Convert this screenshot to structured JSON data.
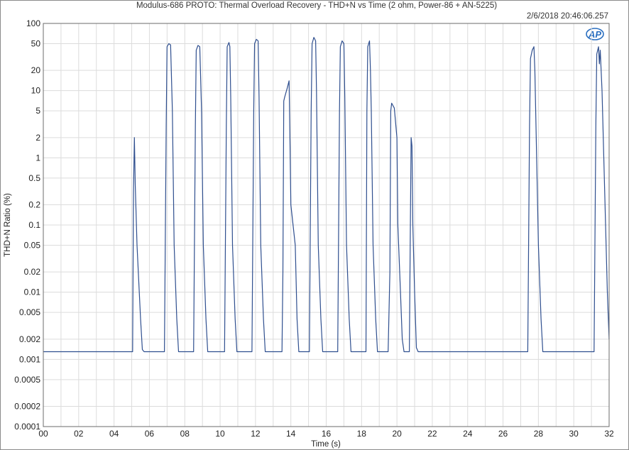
{
  "chart_data": {
    "type": "line",
    "title": "Modulus-686 PROTO: Thermal Overload Recovery - THD+N vs Time (2 ohm, Power-86 + AN-5225)",
    "timestamp": "2/6/2018 20:46:06.257",
    "logo": "AP",
    "xlabel": "Time (s)",
    "ylabel": "THD+N Ratio (%)",
    "x_scale": "linear",
    "y_scale": "log",
    "xlim": [
      0,
      32
    ],
    "ylim": [
      0.0001,
      100
    ],
    "grid": true,
    "x_ticks": [
      {
        "v": 0,
        "label": "00"
      },
      {
        "v": 2,
        "label": "02"
      },
      {
        "v": 4,
        "label": "04"
      },
      {
        "v": 6,
        "label": "06"
      },
      {
        "v": 8,
        "label": "08"
      },
      {
        "v": 10,
        "label": "10"
      },
      {
        "v": 12,
        "label": "12"
      },
      {
        "v": 14,
        "label": "14"
      },
      {
        "v": 16,
        "label": "16"
      },
      {
        "v": 18,
        "label": "18"
      },
      {
        "v": 20,
        "label": "20"
      },
      {
        "v": 22,
        "label": "22"
      },
      {
        "v": 24,
        "label": "24"
      },
      {
        "v": 26,
        "label": "26"
      },
      {
        "v": 28,
        "label": "28"
      },
      {
        "v": 30,
        "label": "30"
      },
      {
        "v": 32,
        "label": "32"
      }
    ],
    "y_ticks": [
      {
        "v": 100,
        "label": "100"
      },
      {
        "v": 50,
        "label": "50"
      },
      {
        "v": 20,
        "label": "20"
      },
      {
        "v": 10,
        "label": "10"
      },
      {
        "v": 5,
        "label": "5"
      },
      {
        "v": 2,
        "label": "2"
      },
      {
        "v": 1,
        "label": "1"
      },
      {
        "v": 0.5,
        "label": "0.5"
      },
      {
        "v": 0.2,
        "label": "0.2"
      },
      {
        "v": 0.1,
        "label": "0.1"
      },
      {
        "v": 0.05,
        "label": "0.05"
      },
      {
        "v": 0.02,
        "label": "0.02"
      },
      {
        "v": 0.01,
        "label": "0.01"
      },
      {
        "v": 0.005,
        "label": "0.005"
      },
      {
        "v": 0.002,
        "label": "0.002"
      },
      {
        "v": 0.001,
        "label": "0.001"
      },
      {
        "v": 0.0005,
        "label": "0.0005"
      },
      {
        "v": 0.0002,
        "label": "0.0002"
      },
      {
        "v": 0.0001,
        "label": "0.0001"
      }
    ],
    "series": [
      {
        "color": "#2f4f8f",
        "points": [
          [
            0,
            0.0013
          ],
          [
            5.05,
            0.0013
          ],
          [
            5.1,
            0.3
          ],
          [
            5.15,
            2.0
          ],
          [
            5.2,
            0.4
          ],
          [
            5.3,
            0.05
          ],
          [
            5.5,
            0.004
          ],
          [
            5.6,
            0.0014
          ],
          [
            5.7,
            0.0013
          ],
          [
            6.85,
            0.0013
          ],
          [
            6.95,
            3.0
          ],
          [
            7.0,
            45
          ],
          [
            7.1,
            50
          ],
          [
            7.2,
            48
          ],
          [
            7.3,
            5
          ],
          [
            7.4,
            0.05
          ],
          [
            7.55,
            0.004
          ],
          [
            7.65,
            0.0013
          ],
          [
            8.5,
            0.0013
          ],
          [
            8.6,
            3.0
          ],
          [
            8.65,
            40
          ],
          [
            8.75,
            47
          ],
          [
            8.85,
            45
          ],
          [
            8.95,
            5
          ],
          [
            9.05,
            0.05
          ],
          [
            9.2,
            0.004
          ],
          [
            9.3,
            0.0013
          ],
          [
            10.25,
            0.0013
          ],
          [
            10.35,
            3.0
          ],
          [
            10.4,
            45
          ],
          [
            10.5,
            52
          ],
          [
            10.55,
            45
          ],
          [
            10.6,
            8
          ],
          [
            10.7,
            0.05
          ],
          [
            10.85,
            0.004
          ],
          [
            10.95,
            0.0013
          ],
          [
            11.8,
            0.0013
          ],
          [
            11.9,
            5
          ],
          [
            11.95,
            50
          ],
          [
            12.05,
            58
          ],
          [
            12.15,
            55
          ],
          [
            12.2,
            8
          ],
          [
            12.3,
            0.05
          ],
          [
            12.45,
            0.004
          ],
          [
            12.55,
            0.0013
          ],
          [
            13.5,
            0.0013
          ],
          [
            13.55,
            0.02
          ],
          [
            13.6,
            7.0
          ],
          [
            13.65,
            8.0
          ],
          [
            13.8,
            11
          ],
          [
            13.9,
            14
          ],
          [
            13.95,
            2.0
          ],
          [
            14.0,
            0.2
          ],
          [
            14.25,
            0.05
          ],
          [
            14.35,
            0.004
          ],
          [
            14.45,
            0.0013
          ],
          [
            15.05,
            0.0013
          ],
          [
            15.15,
            5
          ],
          [
            15.2,
            50
          ],
          [
            15.3,
            62
          ],
          [
            15.4,
            55
          ],
          [
            15.45,
            10
          ],
          [
            15.55,
            0.05
          ],
          [
            15.7,
            0.004
          ],
          [
            15.8,
            0.0013
          ],
          [
            16.65,
            0.0013
          ],
          [
            16.75,
            5
          ],
          [
            16.8,
            45
          ],
          [
            16.9,
            55
          ],
          [
            17.0,
            50
          ],
          [
            17.05,
            8
          ],
          [
            17.15,
            0.05
          ],
          [
            17.3,
            0.004
          ],
          [
            17.4,
            0.0013
          ],
          [
            18.25,
            0.0013
          ],
          [
            18.3,
            5
          ],
          [
            18.35,
            45
          ],
          [
            18.45,
            55
          ],
          [
            18.5,
            20
          ],
          [
            18.55,
            5
          ],
          [
            18.65,
            0.05
          ],
          [
            18.8,
            0.004
          ],
          [
            18.9,
            0.0013
          ],
          [
            19.5,
            0.0013
          ],
          [
            19.6,
            0.02
          ],
          [
            19.65,
            5.0
          ],
          [
            19.7,
            6.5
          ],
          [
            19.85,
            5.5
          ],
          [
            20.0,
            2.0
          ],
          [
            20.05,
            0.1
          ],
          [
            20.2,
            0.01
          ],
          [
            20.3,
            0.002
          ],
          [
            20.4,
            0.0013
          ],
          [
            20.7,
            0.0013
          ],
          [
            20.75,
            0.05
          ],
          [
            20.8,
            2.0
          ],
          [
            20.85,
            1.5
          ],
          [
            20.9,
            0.1
          ],
          [
            21.0,
            0.01
          ],
          [
            21.1,
            0.0015
          ],
          [
            21.2,
            0.0013
          ],
          [
            27.4,
            0.0013
          ],
          [
            27.5,
            3
          ],
          [
            27.55,
            30
          ],
          [
            27.65,
            40
          ],
          [
            27.75,
            45
          ],
          [
            27.8,
            20
          ],
          [
            27.9,
            1
          ],
          [
            28.0,
            0.05
          ],
          [
            28.15,
            0.004
          ],
          [
            28.25,
            0.0013
          ],
          [
            31.15,
            0.0013
          ],
          [
            31.25,
            3
          ],
          [
            31.3,
            35
          ],
          [
            31.4,
            45
          ],
          [
            31.45,
            25
          ],
          [
            31.5,
            40
          ],
          [
            31.6,
            10
          ],
          [
            31.7,
            1.0
          ],
          [
            31.8,
            0.1
          ],
          [
            31.9,
            0.01
          ],
          [
            32.0,
            0.002
          ]
        ]
      }
    ]
  }
}
